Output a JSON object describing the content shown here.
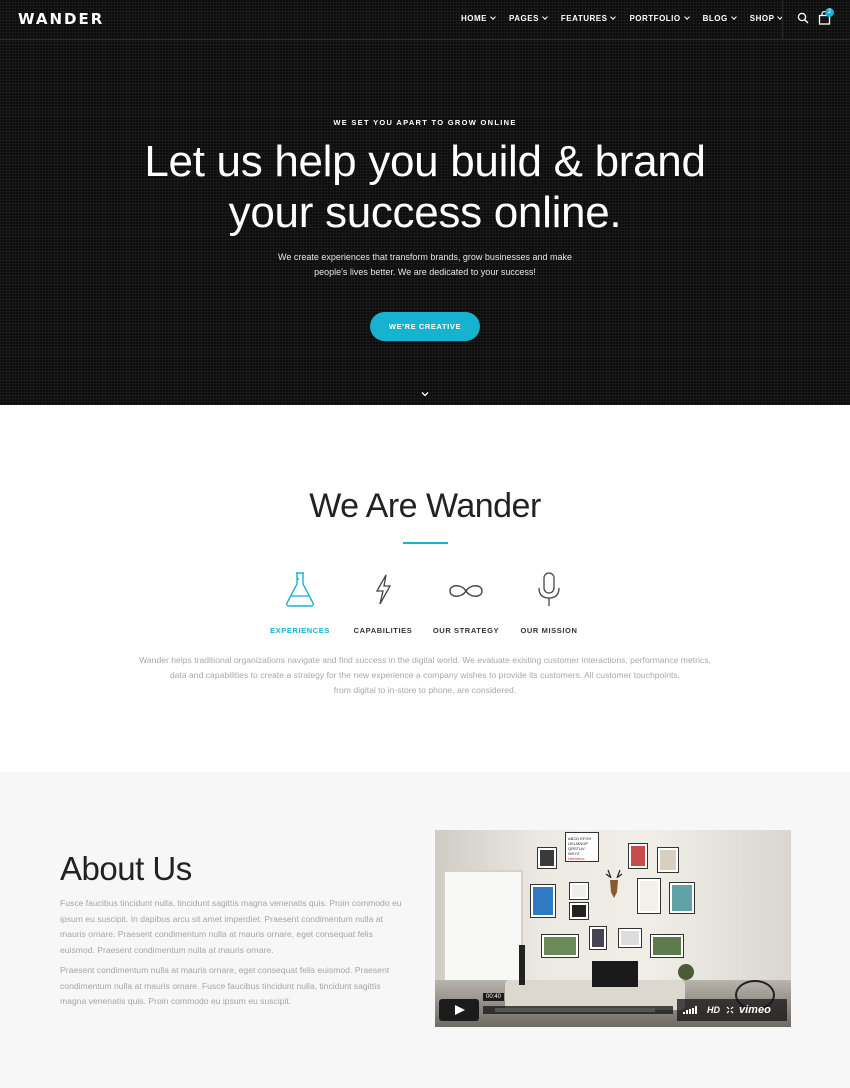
{
  "brand": {
    "logo": "WANDER",
    "accent": "#16b3d1"
  },
  "nav": {
    "items": [
      "HOME",
      "PAGES",
      "FEATURES",
      "PORTFOLIO",
      "BLOG",
      "SHOP"
    ],
    "cart_count": "2",
    "icons": [
      "search-icon",
      "shopping-bag-icon"
    ]
  },
  "hero": {
    "eyebrow": "WE SET YOU APART TO GROW ONLINE",
    "headline_line1": "Let us help you build & brand",
    "headline_line2": "your success online.",
    "subtext_line1": "We create experiences that transform brands, grow businesses and make",
    "subtext_line2": "people's lives better. We are dedicated to your success!",
    "cta_label": "WE'RE CREATIVE"
  },
  "wander": {
    "title": "We Are Wander",
    "tabs": [
      {
        "label": "EXPERIENCES",
        "icon": "flask-icon",
        "active": true
      },
      {
        "label": "CAPABILITIES",
        "icon": "lightning-icon",
        "active": false
      },
      {
        "label": "OUR STRATEGY",
        "icon": "infinity-icon",
        "active": false
      },
      {
        "label": "OUR MISSION",
        "icon": "microphone-icon",
        "active": false
      }
    ],
    "text_line1": "Wander helps traditional organizations navigate and find success in the digital world. We evaluate existing customer interactions, performance metrics,",
    "text_line2": "data and capabilities to create a strategy for the new experience a company wishes to provide its customers. All customer touchpoints,",
    "text_line3": "from digital to in-store to phone, are considered."
  },
  "about": {
    "title": "About Us",
    "p1": "Fusce faucibus tincidunt nulla, tincidunt sagittis magna venenatis quis. Proin commodo eu ipsum eu suscipit. In dapibus arcu sit amet imperdiet. Praesent condimentum nulla at mauris ornare. Praesent condimentum nulla at mauris ornare, eget consequat felis euismod. Praesent condimentum nulla at mauris ornare.",
    "p2": "Praesent condimentum nulla at mauris ornare, eget consequat felis euismod. Praesent condimentum nulla at mauris ornare. Fusce faucibus tincidunt nulla, tincidunt sagittis magna venenatis quis. Proin commodo eu ipsum eu suscipit.",
    "video": {
      "time": "00:40",
      "hd": "HD",
      "provider": "vimeo",
      "art_text": "ABCD EFGHIJ KLMNOP QRSTUV WXYZ Helvetica"
    }
  }
}
